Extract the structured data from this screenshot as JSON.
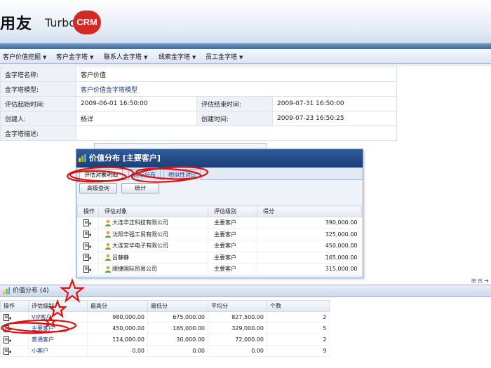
{
  "brand": {
    "logo_text": "用友",
    "turbo": "Turbo",
    "crm": "CRM"
  },
  "menu": [
    {
      "label": "客户价值挖掘"
    },
    {
      "label": "客户金字塔"
    },
    {
      "label": "联系人金字塔"
    },
    {
      "label": "线索金字塔"
    },
    {
      "label": "员工金字塔"
    }
  ],
  "info": {
    "name_label": "金字塔名称:",
    "name_value": "客户价值",
    "model_label": "金字塔模型:",
    "model_value": "客户价值金字塔模型",
    "start_label": "评估起始时间:",
    "start_value": "2009-06-01 16:50:00",
    "end_label": "评估结束时间:",
    "end_value": "2009-07-31 16:50:00",
    "creator_label": "创建人:",
    "creator_value": "杨详",
    "created_label": "创建时间:",
    "created_value": "2009-07-23 16:50:25",
    "desc_label": "金字塔描述:",
    "desc_value": ""
  },
  "popup": {
    "title": "价值分布 [主要客户]",
    "tabs": [
      "评估对象明细",
      "指标分布",
      "相似性对比"
    ],
    "buttons": {
      "advanced": "高级查询",
      "stats": "统计"
    },
    "columns": [
      "操作",
      "评估对象",
      "评估级别",
      "得分"
    ],
    "rows": [
      {
        "name": "大连华正科技有限公司",
        "level": "主要客户",
        "score": "390,000.00"
      },
      {
        "name": "沈阳华强工贸有限公司",
        "level": "主要客户",
        "score": "325,000.00"
      },
      {
        "name": "大连安华电子有限公司",
        "level": "主要客户",
        "score": "450,000.00"
      },
      {
        "name": "吕静静",
        "level": "主要客户",
        "score": "165,000.00"
      },
      {
        "name": "顺捷国际贸易公司",
        "level": "主要客户",
        "score": "315,000.00"
      }
    ]
  },
  "panel": {
    "title": "价值分布 (4)",
    "columns": [
      "操作",
      "评估级别",
      "最高分",
      "最低分",
      "平均分",
      "个数"
    ],
    "rows": [
      {
        "level": "VIP客户",
        "max": "980,000.00",
        "min": "675,000.00",
        "avg": "827,500.00",
        "count": "2"
      },
      {
        "level": "主要客户",
        "max": "450,000.00",
        "min": "165,000.00",
        "avg": "329,000.00",
        "count": "5"
      },
      {
        "level": "普通客户",
        "max": "114,000.00",
        "min": "30,000.00",
        "avg": "72,000.00",
        "count": "2"
      },
      {
        "level": "小客户",
        "max": "0.00",
        "min": "0.00",
        "avg": "0.00",
        "count": "9"
      }
    ]
  },
  "colors": {
    "annotation": "#e01010",
    "title_bar": "#1c3f78",
    "link": "#1a3d8f"
  }
}
